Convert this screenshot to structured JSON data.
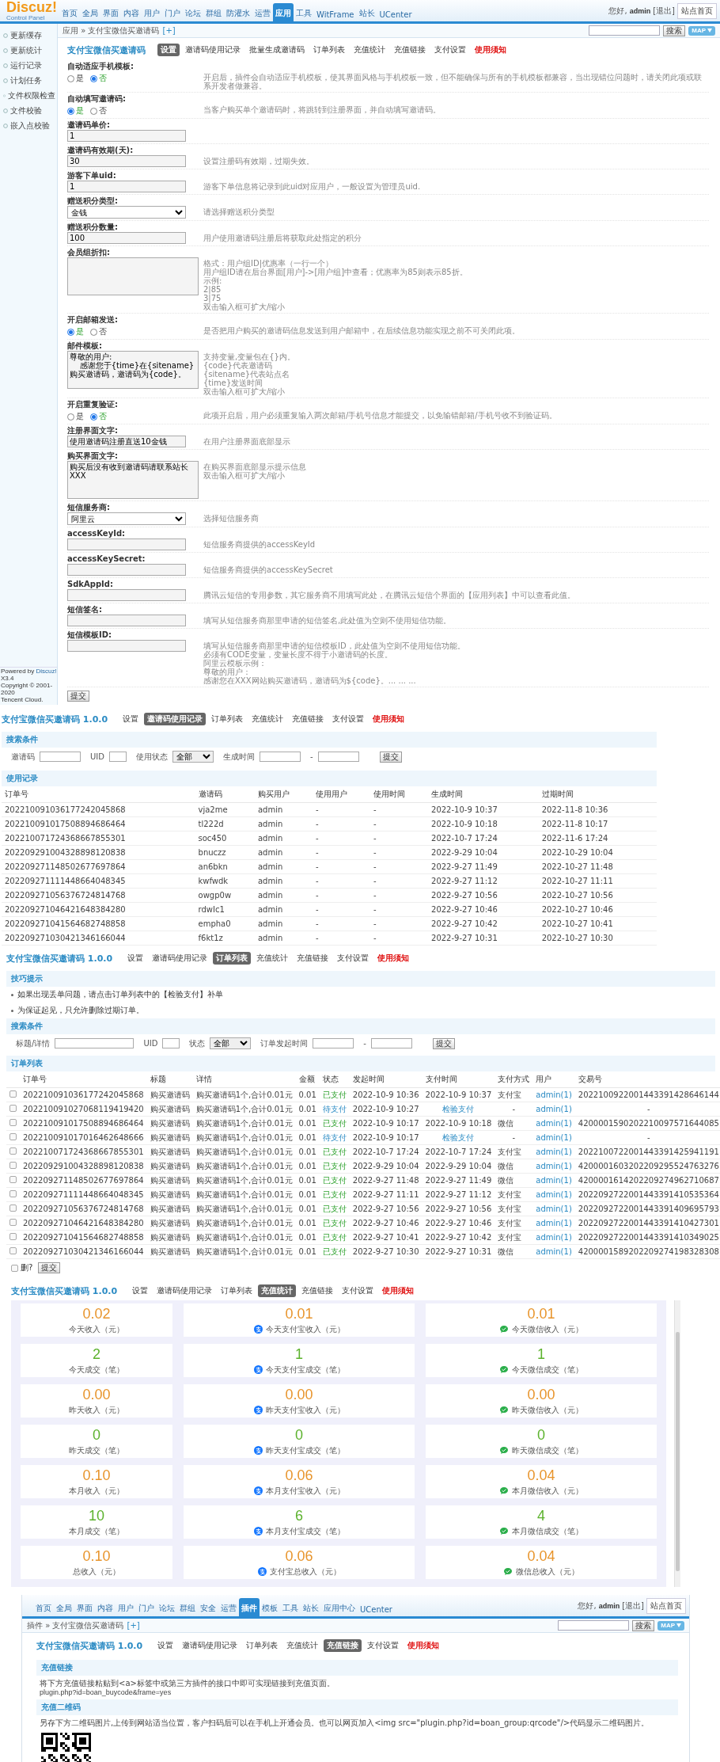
{
  "admin_screen": {
    "header": {
      "logo": "Discuz!",
      "logo_subtitle": "Control Panel",
      "nav": [
        {
          "label": "首页",
          "selected": false
        },
        {
          "label": "全局",
          "selected": false
        },
        {
          "label": "界面",
          "selected": false
        },
        {
          "label": "内容",
          "selected": false
        },
        {
          "label": "用户",
          "selected": false
        },
        {
          "label": "门户",
          "selected": false
        },
        {
          "label": "论坛",
          "selected": false
        },
        {
          "label": "群组",
          "selected": false
        },
        {
          "label": "防灌水",
          "selected": false
        },
        {
          "label": "运营",
          "selected": false
        },
        {
          "label": "应用",
          "selected": true
        },
        {
          "label": "工具",
          "selected": false
        },
        {
          "label": "WitFrame",
          "selected": false
        },
        {
          "label": "站长",
          "selected": false
        },
        {
          "label": "UCenter",
          "selected": false
        }
      ],
      "greeting": "您好,",
      "user": "admin",
      "logout": "[退出]",
      "home_button": "站点首页"
    },
    "breadcrumb": {
      "path": "应用 » 支付宝微信买邀请码",
      "add": "[+]",
      "search_button": "搜索",
      "map_button": "MAP"
    },
    "sidebar": {
      "items": [
        "更新缓存",
        "更新统计",
        "运行记录",
        "计划任务",
        "文件权限检查",
        "文件校验",
        "嵌入点校验"
      ],
      "powered_by": "Powered by",
      "powered_link": "Discuz!",
      "version": "X3.4",
      "copyright": "Copyright © 2001-2020",
      "company": "Tencent Cloud."
    },
    "plugin_nav": {
      "title": "支付宝微信买邀请码",
      "tabs": [
        {
          "label": "设置",
          "selected": true,
          "kind": "tab"
        },
        {
          "label": "邀请码使用记录",
          "selected": false,
          "kind": "tab"
        },
        {
          "label": "批量生成邀请码",
          "selected": false,
          "kind": "tab"
        },
        {
          "label": "订单列表",
          "selected": false,
          "kind": "tab"
        },
        {
          "label": "充值统计",
          "selected": false,
          "kind": "tab"
        },
        {
          "label": "充值链接",
          "selected": false,
          "kind": "tab"
        },
        {
          "label": "支付设置",
          "selected": false,
          "kind": "tab"
        },
        {
          "label": "使用须知",
          "selected": false,
          "kind": "notice"
        }
      ]
    },
    "settings": [
      {
        "label": "自动适应手机模板:",
        "kind": "radio",
        "options": [
          {
            "label": "是",
            "selected": false
          },
          {
            "label": "否",
            "selected": true
          }
        ],
        "help": [
          "开启后，插件会自动适应手机模板，使其界面风格与手机模板一致，但不能确保与所有的手机模板都兼容，当出现错位问题时，请关闭此项或联系开发者做兼容。"
        ]
      },
      {
        "label": "自动填写邀请码:",
        "kind": "radio",
        "options": [
          {
            "label": "是",
            "selected": true
          },
          {
            "label": "否",
            "selected": false
          }
        ],
        "help": [
          "当客户购买单个邀请码时，将跳转到注册界面，并自动填写邀请码。"
        ]
      },
      {
        "label": "邀请码单价:",
        "kind": "text",
        "value": "1"
      },
      {
        "label": "邀请码有效期(天):",
        "kind": "text",
        "value": "30",
        "help": [
          "设置注册码有效期，过期失效。"
        ]
      },
      {
        "label": "游客下单uid:",
        "kind": "text",
        "value": "1",
        "help": [
          "游客下单信息将记录到此uid对应用户，一般设置为管理员uid."
        ]
      },
      {
        "label": "赠送积分类型:",
        "kind": "select",
        "value": "金钱",
        "help": [
          "请选择赠送积分类型"
        ]
      },
      {
        "label": "赠送积分数量:",
        "kind": "text",
        "value": "100",
        "help": [
          "用户使用邀请码注册后将获取此处指定的积分"
        ]
      },
      {
        "label": "会员组折扣:",
        "kind": "textarea",
        "help": [
          "格式：用户组ID|优惠率（一行一个）",
          "用户组ID请在后台界面[用户]->[用户组]中查看；优惠率为85则表示85折。",
          "示例:",
          "2|85",
          "3|75",
          "双击输入框可扩大/缩小"
        ]
      },
      {
        "label": "开启邮箱发送:",
        "kind": "radio",
        "options": [
          {
            "label": "是",
            "selected": true
          },
          {
            "label": "否",
            "selected": false
          }
        ],
        "help": [
          "是否把用户购买的邀请码信息发送到用户邮箱中，在后续信息功能实现之前不可关闭此项。"
        ]
      },
      {
        "label": "邮件模板:",
        "kind": "textarea",
        "value": "尊敬的用户:\n    感谢您于{time}在{sitename}购买邀请码，邀请码为{code}。",
        "help": [
          "支持变量,变量包在{}内。",
          "{code}代表邀请码",
          "{sitename}代表站点名",
          "{time}发送时间",
          "双击输入框可扩大/缩小"
        ]
      },
      {
        "label": "开启重复验证:",
        "kind": "radio",
        "options": [
          {
            "label": "是",
            "selected": false
          },
          {
            "label": "否",
            "selected": true
          }
        ],
        "help": [
          "此项开启后，用户必须重复输入两次邮箱/手机号信息才能提交，以免输错邮箱/手机号收不到验证码。"
        ]
      },
      {
        "label": "注册界面文字:",
        "kind": "text",
        "value": "使用邀请码注册直送10金钱",
        "help": [
          "在用户注册界面底部显示"
        ]
      },
      {
        "label": "购买界面文字:",
        "kind": "textarea",
        "value": "购买后没有收到邀请码请联系站长XXX",
        "help": [
          "在购买界面底部显示提示信息",
          "双击输入框可扩大/缩小"
        ]
      },
      {
        "label": "短信服务商:",
        "kind": "select",
        "value": "阿里云",
        "help": [
          "选择短信服务商"
        ]
      },
      {
        "label": "accessKeyId:",
        "kind": "text",
        "help": [
          "短信服务商提供的accessKeyId"
        ]
      },
      {
        "label": "accessKeySecret:",
        "kind": "text",
        "help": [
          "短信服务商提供的accessKeySecret"
        ]
      },
      {
        "label": "SdkAppId:",
        "kind": "text",
        "help": [
          "腾讯云短信的专用参数，其它服务商不用填写此处，在腾讯云短信个界面的【应用列表】中可以查看此值。"
        ]
      },
      {
        "label": "短信签名:",
        "kind": "text",
        "help": [
          "填写从短信服务商那里申请的短信签名,此处值为空则不使用短信功能。"
        ]
      },
      {
        "label": "短信模板ID:",
        "kind": "text",
        "help": [
          "填写从短信服务商那里申请的短信模板ID，此处值为空则不使用短信功能。",
          "必须有CODE变量，变量长度不得于小邀请码的长度。",
          "阿里云模板示例：",
          "尊敬的用户：",
          "感谢您在XXX网站购买邀请码，邀请码为${code}。... ... ..."
        ]
      }
    ],
    "submit": "提交"
  },
  "records_screen": {
    "plugin_nav": {
      "title": "支付宝微信买邀请码 1.0.0",
      "tabs": [
        {
          "label": "设置",
          "selected": false,
          "kind": "tab"
        },
        {
          "label": "邀请码使用记录",
          "selected": true,
          "kind": "tab"
        },
        {
          "label": "订单列表",
          "selected": false,
          "kind": "tab"
        },
        {
          "label": "充值统计",
          "selected": false,
          "kind": "tab"
        },
        {
          "label": "充值链接",
          "selected": false,
          "kind": "tab"
        },
        {
          "label": "支付设置",
          "selected": false,
          "kind": "tab"
        },
        {
          "label": "使用须知",
          "selected": false,
          "kind": "notice"
        }
      ]
    },
    "search": {
      "heading": "搜索条件",
      "fields": [
        {
          "label": "邀请码",
          "kind": "text"
        },
        {
          "label": "UID",
          "kind": "short"
        },
        {
          "label": "使用状态",
          "kind": "select",
          "value": "全部"
        },
        {
          "label": "生成时间",
          "kind": "range",
          "separator": "-"
        }
      ],
      "submit": "提交"
    },
    "table": {
      "heading": "使用记录",
      "columns": [
        "订单号",
        "邀请码",
        "购买用户",
        "使用用户",
        "使用时间",
        "生成时间",
        "过期时间"
      ],
      "rows": [
        [
          "202210091036177242045868",
          "vja2me",
          "admin",
          "-",
          "-",
          "2022-10-9 10:37",
          "2022-11-8 10:36"
        ],
        [
          "202210091017508894686464",
          "tl222d",
          "admin",
          "-",
          "-",
          "2022-10-9 10:18",
          "2022-11-8 10:17"
        ],
        [
          "202210071724368667855301",
          "soc450",
          "admin",
          "-",
          "-",
          "2022-10-7 17:24",
          "2022-11-6 17:24"
        ],
        [
          "202209291004328898120838",
          "bnuczz",
          "admin",
          "-",
          "-",
          "2022-9-29 10:04",
          "2022-10-29 10:04"
        ],
        [
          "202209271148502677697864",
          "an6bkn",
          "admin",
          "-",
          "-",
          "2022-9-27 11:49",
          "2022-10-27 11:48"
        ],
        [
          "202209271111448664048345",
          "kwfwdk",
          "admin",
          "-",
          "-",
          "2022-9-27 11:12",
          "2022-10-27 11:11"
        ],
        [
          "202209271056376724814768",
          "owgp0w",
          "admin",
          "-",
          "-",
          "2022-9-27 10:56",
          "2022-10-27 10:56"
        ],
        [
          "202209271046421648384280",
          "rdwIc1",
          "admin",
          "-",
          "-",
          "2022-9-27 10:46",
          "2022-10-27 10:46"
        ],
        [
          "202209271041564682748858",
          "empha0",
          "admin",
          "-",
          "-",
          "2022-9-27 10:42",
          "2022-10-27 10:41"
        ],
        [
          "202209271030421346166044",
          "f6kt1z",
          "admin",
          "-",
          "-",
          "2022-9-27 10:31",
          "2022-10-27 10:30"
        ]
      ]
    }
  },
  "orders_screen": {
    "plugin_nav": {
      "title": "支付宝微信买邀请码 1.0.0",
      "tabs": [
        {
          "label": "设置",
          "selected": false,
          "kind": "tab"
        },
        {
          "label": "邀请码使用记录",
          "selected": false,
          "kind": "tab"
        },
        {
          "label": "订单列表",
          "selected": true,
          "kind": "tab"
        },
        {
          "label": "充值统计",
          "selected": false,
          "kind": "tab"
        },
        {
          "label": "充值链接",
          "selected": false,
          "kind": "tab"
        },
        {
          "label": "支付设置",
          "selected": false,
          "kind": "tab"
        },
        {
          "label": "使用须知",
          "selected": false,
          "kind": "notice"
        }
      ]
    },
    "tips": {
      "heading": "技巧提示",
      "items": [
        "如果出现丢单问题，请点击订单列表中的【检验支付】补单",
        "为保证起见，只允许删除过期订单。"
      ]
    },
    "search": {
      "heading": "搜索条件",
      "fields": [
        {
          "label": "标题/详情",
          "kind": "text"
        },
        {
          "label": "UID",
          "kind": "short"
        },
        {
          "label": "状态",
          "kind": "select",
          "value": "全部"
        },
        {
          "label": "订单发起时间",
          "kind": "range",
          "separator": "-"
        }
      ],
      "submit": "提交"
    },
    "table": {
      "heading": "订单列表",
      "columns": [
        "订单号",
        "标题",
        "详情",
        "金额",
        "状态",
        "发起时间",
        "支付时间",
        "支付方式",
        "用户",
        "交易号"
      ],
      "rows": [
        {
          "checked": false,
          "paid": true,
          "order_no": "202210091036177242045868",
          "title": "购买邀请码",
          "detail": "购买邀请码1个,合计0.01元",
          "amount": "0.01",
          "status": "已支付",
          "created": "2022-10-9 10:36",
          "pay_time": "2022-10-9 10:37",
          "method": "支付宝",
          "user": "admin(1)",
          "trade_no": "2022100922001443391428646144"
        },
        {
          "checked": false,
          "paid": false,
          "order_no": "202210091027068119419420",
          "title": "购买邀请码",
          "detail": "购买邀请码1个,合计0.01元",
          "amount": "0.01",
          "status": "待支付",
          "created": "2022-10-9 10:27",
          "pay_time": "检验支付",
          "method": "-",
          "user": "admin(1)",
          "trade_no": "-"
        },
        {
          "checked": false,
          "paid": true,
          "order_no": "202210091017508894686464",
          "title": "购买邀请码",
          "detail": "购买邀请码1个,合计0.01元",
          "amount": "0.01",
          "status": "已支付",
          "created": "2022-10-9 10:17",
          "pay_time": "2022-10-9 10:18",
          "method": "微信",
          "user": "admin(1)",
          "trade_no": "4200001590202210097571644085"
        },
        {
          "checked": false,
          "paid": false,
          "order_no": "202210091017016462648666",
          "title": "购买邀请码",
          "detail": "购买邀请码1个,合计0.01元",
          "amount": "0.01",
          "status": "待支付",
          "created": "2022-10-9 10:17",
          "pay_time": "检验支付",
          "method": "-",
          "user": "admin(1)",
          "trade_no": "-"
        },
        {
          "checked": false,
          "paid": true,
          "order_no": "202210071724368667855301",
          "title": "购买邀请码",
          "detail": "购买邀请码1个,合计0.01元",
          "amount": "0.01",
          "status": "已支付",
          "created": "2022-10-7 17:24",
          "pay_time": "2022-10-7 17:24",
          "method": "支付宝",
          "user": "admin(1)",
          "trade_no": "2022100722001443391425941191"
        },
        {
          "checked": false,
          "paid": true,
          "order_no": "202209291004328898120838",
          "title": "购买邀请码",
          "detail": "购买邀请码1个,合计0.01元",
          "amount": "0.01",
          "status": "已支付",
          "created": "2022-9-29 10:04",
          "pay_time": "2022-9-29 10:04",
          "method": "微信",
          "user": "admin(1)",
          "trade_no": "4200001603202209295524763276"
        },
        {
          "checked": false,
          "paid": true,
          "order_no": "202209271148502677697864",
          "title": "购买邀请码",
          "detail": "购买邀请码1个,合计0.01元",
          "amount": "0.01",
          "status": "已支付",
          "created": "2022-9-27 11:48",
          "pay_time": "2022-9-27 11:49",
          "method": "微信",
          "user": "admin(1)",
          "trade_no": "4200001614202209274962710687"
        },
        {
          "checked": false,
          "paid": true,
          "order_no": "202209271111448664048345",
          "title": "购买邀请码",
          "detail": "购买邀请码1个,合计0.01元",
          "amount": "0.01",
          "status": "已支付",
          "created": "2022-9-27 11:11",
          "pay_time": "2022-9-27 11:12",
          "method": "支付宝",
          "user": "admin(1)",
          "trade_no": "2022092722001443391410535364"
        },
        {
          "checked": false,
          "paid": true,
          "order_no": "202209271056376724814768",
          "title": "购买邀请码",
          "detail": "购买邀请码1个,合计0.01元",
          "amount": "0.01",
          "status": "已支付",
          "created": "2022-9-27 10:56",
          "pay_time": "2022-9-27 10:56",
          "method": "支付宝",
          "user": "admin(1)",
          "trade_no": "2022092722001443391409695793"
        },
        {
          "checked": false,
          "paid": true,
          "order_no": "202209271046421648384280",
          "title": "购买邀请码",
          "detail": "购买邀请码1个,合计0.01元",
          "amount": "0.01",
          "status": "已支付",
          "created": "2022-9-27 10:46",
          "pay_time": "2022-9-27 10:46",
          "method": "支付宝",
          "user": "admin(1)",
          "trade_no": "2022092722001443391410427301"
        },
        {
          "checked": false,
          "paid": true,
          "order_no": "202209271041564682748858",
          "title": "购买邀请码",
          "detail": "购买邀请码1个,合计0.01元",
          "amount": "0.01",
          "status": "已支付",
          "created": "2022-9-27 10:41",
          "pay_time": "2022-9-27 10:42",
          "method": "支付宝",
          "user": "admin(1)",
          "trade_no": "2022092722001443391410349025"
        },
        {
          "checked": false,
          "paid": true,
          "order_no": "202209271030421346166044",
          "title": "购买邀请码",
          "detail": "购买邀请码1个,合计0.01元",
          "amount": "0.01",
          "status": "已支付",
          "created": "2022-9-27 10:30",
          "pay_time": "2022-9-27 10:31",
          "method": "微信",
          "user": "admin(1)",
          "trade_no": "4200001589202209274198328308"
        }
      ]
    },
    "delete_label": "删?",
    "delete_checked": false,
    "submit": "提交"
  },
  "stats_screen": {
    "plugin_nav": {
      "title": "支付宝微信买邀请码 1.0.0",
      "tabs": [
        {
          "label": "设置",
          "selected": false,
          "kind": "tab"
        },
        {
          "label": "邀请码使用记录",
          "selected": false,
          "kind": "tab"
        },
        {
          "label": "订单列表",
          "selected": false,
          "kind": "tab"
        },
        {
          "label": "充值统计",
          "selected": true,
          "kind": "tab"
        },
        {
          "label": "充值链接",
          "selected": false,
          "kind": "tab"
        },
        {
          "label": "支付设置",
          "selected": false,
          "kind": "tab"
        },
        {
          "label": "使用须知",
          "selected": false,
          "kind": "notice"
        }
      ]
    },
    "cards": [
      {
        "value": "0.02",
        "label": "今天收入（元）",
        "kind": "total_money"
      },
      {
        "value": "0.01",
        "label": "今天支付宝收入（元）",
        "kind": "alipay_money"
      },
      {
        "value": "0.01",
        "label": "今天微信收入（元）",
        "kind": "wechat_money"
      },
      {
        "value": "2",
        "label": "今天成交（笔）",
        "kind": "total_count"
      },
      {
        "value": "1",
        "label": "今天支付宝成交（笔）",
        "kind": "alipay_count"
      },
      {
        "value": "1",
        "label": "今天微信成交（笔）",
        "kind": "wechat_count"
      },
      {
        "value": "0.00",
        "label": "昨天收入（元）",
        "kind": "total_money"
      },
      {
        "value": "0.00",
        "label": "昨天支付宝收入（元）",
        "kind": "alipay_money"
      },
      {
        "value": "0.00",
        "label": "昨天微信收入（元）",
        "kind": "wechat_money"
      },
      {
        "value": "0",
        "label": "昨天成交（笔）",
        "kind": "total_count"
      },
      {
        "value": "0",
        "label": "昨天支付宝成交（笔）",
        "kind": "alipay_count"
      },
      {
        "value": "0",
        "label": "昨天微信成交（笔）",
        "kind": "wechat_count"
      },
      {
        "value": "0.10",
        "label": "本月收入（元）",
        "kind": "total_money"
      },
      {
        "value": "0.06",
        "label": "本月支付宝收入（元）",
        "kind": "alipay_money"
      },
      {
        "value": "0.04",
        "label": "本月微信收入（元）",
        "kind": "wechat_money"
      },
      {
        "value": "10",
        "label": "本月成交（笔）",
        "kind": "total_count"
      },
      {
        "value": "6",
        "label": "本月支付宝成交（笔）",
        "kind": "alipay_count"
      },
      {
        "value": "4",
        "label": "本月微信成交（笔）",
        "kind": "wechat_count"
      },
      {
        "value": "0.10",
        "label": "总收入（元）",
        "kind": "total_money"
      },
      {
        "value": "0.06",
        "label": "支付宝总收入（元）",
        "kind": "alipay_money"
      },
      {
        "value": "0.04",
        "label": "微信总收入（元）",
        "kind": "wechat_money"
      }
    ]
  },
  "links_screen": {
    "header": {
      "nav": [
        {
          "label": "首页",
          "selected": false
        },
        {
          "label": "全局",
          "selected": false
        },
        {
          "label": "界面",
          "selected": false
        },
        {
          "label": "内容",
          "selected": false
        },
        {
          "label": "用户",
          "selected": false
        },
        {
          "label": "门户",
          "selected": false
        },
        {
          "label": "论坛",
          "selected": false
        },
        {
          "label": "群组",
          "selected": false
        },
        {
          "label": "安全",
          "selected": false
        },
        {
          "label": "运营",
          "selected": false
        },
        {
          "label": "插件",
          "selected": true
        },
        {
          "label": "模板",
          "selected": false
        },
        {
          "label": "工具",
          "selected": false
        },
        {
          "label": "站长",
          "selected": false
        },
        {
          "label": "应用中心",
          "selected": false
        },
        {
          "label": "UCenter",
          "selected": false
        }
      ],
      "greeting": "您好,",
      "user": "admin",
      "logout": "[退出]",
      "home_button": "站点首页"
    },
    "breadcrumb": {
      "path": "插件 » 支付宝微信买邀请码",
      "add": "[+]",
      "search_button": "搜索",
      "map_button": "MAP"
    },
    "plugin_nav": {
      "title": "支付宝微信买邀请码 1.0.0",
      "tabs": [
        {
          "label": "设置",
          "selected": false,
          "kind": "tab"
        },
        {
          "label": "邀请码使用记录",
          "selected": false,
          "kind": "tab"
        },
        {
          "label": "订单列表",
          "selected": false,
          "kind": "tab"
        },
        {
          "label": "充值统计",
          "selected": false,
          "kind": "tab"
        },
        {
          "label": "充值链接",
          "selected": true,
          "kind": "tab"
        },
        {
          "label": "支付设置",
          "selected": false,
          "kind": "tab"
        },
        {
          "label": "使用须知",
          "selected": false,
          "kind": "notice"
        }
      ]
    },
    "link_section": {
      "heading": "充值链接",
      "text": "将下方充值链接粘贴到<a>标签中或第三方插件的接口中即可实现链接到充值页面。",
      "url": "plugin.php?id=boan_buycode&frame=yes"
    },
    "qr_section": {
      "heading": "充值二维码",
      "text": "另存下方二维码图片,上传到网站适当位置，客户扫码后可以在手机上开通会员。也可以网页加入<img src=\"plugin.php?id=boan_group:qrcode\"/>代码显示二维码图片。"
    }
  }
}
